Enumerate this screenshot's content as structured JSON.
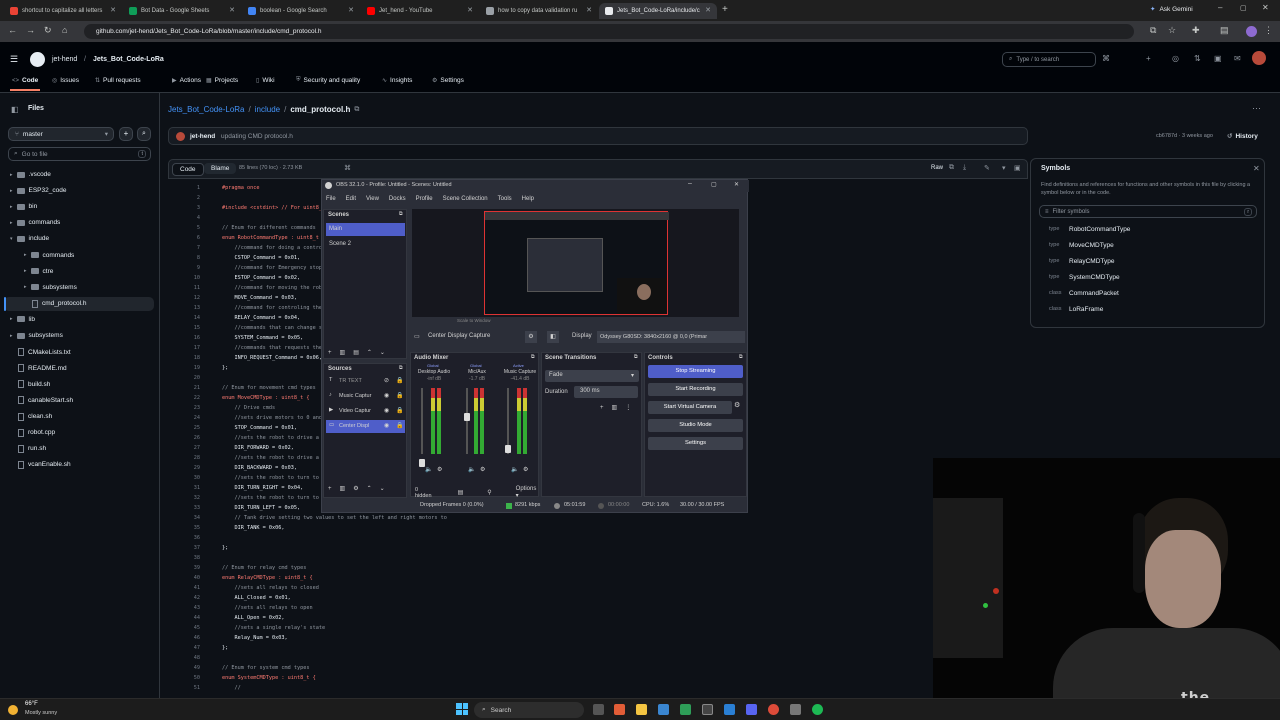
{
  "browser": {
    "tabs": [
      {
        "title": "shortcut to capitalize all letters",
        "color": "#ea4335"
      },
      {
        "title": "Bot Data - Google Sheets",
        "color": "#0f9d58"
      },
      {
        "title": "boolean - Google Search",
        "color": "#4285f4"
      },
      {
        "title": "Jet_hend - YouTube",
        "color": "#ff0000"
      },
      {
        "title": "how to copy data validation ru",
        "color": "#9aa0a6"
      },
      {
        "title": "Jets_Bot_Code-LoRa/include/c",
        "color": "#e8eaed"
      }
    ],
    "ask_gemini": "Ask Gemini",
    "url": "github.com/jet-hend/Jets_Bot_Code-LoRa/blob/master/include/cmd_protocol.h"
  },
  "github": {
    "owner": "jet-hend",
    "repo": "Jets_Bot_Code-LoRa",
    "search_placeholder": "Type / to search",
    "nav": [
      "Code",
      "Issues",
      "Pull requests",
      "Actions",
      "Projects",
      "Wiki",
      "Security and quality",
      "Insights",
      "Settings"
    ],
    "files_title": "Files",
    "branch": "master",
    "goto_placeholder": "Go to file",
    "goto_key": "t",
    "tree": [
      {
        "name": ".vscode",
        "type": "folder",
        "depth": 1
      },
      {
        "name": "ESP32_code",
        "type": "folder",
        "depth": 1
      },
      {
        "name": "bin",
        "type": "folder",
        "depth": 1
      },
      {
        "name": "commands",
        "type": "folder",
        "depth": 1
      },
      {
        "name": "include",
        "type": "folder",
        "depth": 1
      },
      {
        "name": "commands",
        "type": "folder",
        "depth": 2
      },
      {
        "name": "ctre",
        "type": "folder",
        "depth": 2
      },
      {
        "name": "subsystems",
        "type": "folder",
        "depth": 2
      },
      {
        "name": "cmd_protocol.h",
        "type": "file",
        "depth": 2
      },
      {
        "name": "lib",
        "type": "folder",
        "depth": 1
      },
      {
        "name": "subsystems",
        "type": "folder",
        "depth": 1
      },
      {
        "name": "CMakeLists.txt",
        "type": "file",
        "depth": 1
      },
      {
        "name": "README.md",
        "type": "file",
        "depth": 1
      },
      {
        "name": "build.sh",
        "type": "file",
        "depth": 1
      },
      {
        "name": "canableStart.sh",
        "type": "file",
        "depth": 1
      },
      {
        "name": "clean.sh",
        "type": "file",
        "depth": 1
      },
      {
        "name": "robot.cpp",
        "type": "file",
        "depth": 1
      },
      {
        "name": "run.sh",
        "type": "file",
        "depth": 1
      },
      {
        "name": "vcanEnable.sh",
        "type": "file",
        "depth": 1
      }
    ],
    "breadcrumb": {
      "repo": "Jets_Bot_Code-LoRa",
      "sep": "/",
      "dir": "include",
      "file": "cmd_protocol.h"
    },
    "commit": {
      "author": "jet-hend",
      "message": "updating CMD protocol.h",
      "meta": "cb6787d · 3 weeks ago",
      "history": "History"
    },
    "code_tab": "Code",
    "blame_tab": "Blame",
    "file_info": "85 lines (70 loc) · 2.73 KB",
    "raw": "Raw",
    "code_lines": [
      {
        "n": "1",
        "t": "#pragma once"
      },
      {
        "n": "2",
        "t": ""
      },
      {
        "n": "3",
        "t": "#include <cstdint> // For uint8_t"
      },
      {
        "n": "4",
        "t": ""
      },
      {
        "n": "5",
        "t": "// Enum for different commands"
      },
      {
        "n": "6",
        "t": "enum RobotCommandType : uint8_t {"
      },
      {
        "n": "7",
        "t": "    //command for doing a control"
      },
      {
        "n": "8",
        "t": "    CSTOP_Command = 0x01,"
      },
      {
        "n": "9",
        "t": "    //command for Emergency stop"
      },
      {
        "n": "10",
        "t": "    ESTOP_Command = 0x02,"
      },
      {
        "n": "11",
        "t": "    //command for moving the rob"
      },
      {
        "n": "12",
        "t": "    MOVE_Command = 0x03,"
      },
      {
        "n": "13",
        "t": "    //command for controling the"
      },
      {
        "n": "14",
        "t": "    RELAY_Command = 0x04,"
      },
      {
        "n": "15",
        "t": "    //commands that can change s"
      },
      {
        "n": "16",
        "t": "    SYSTEM_Command = 0x05,"
      },
      {
        "n": "17",
        "t": "    //commands that requests the"
      },
      {
        "n": "18",
        "t": "    INFO_REQUEST_Command = 0x06,"
      },
      {
        "n": "19",
        "t": "};"
      },
      {
        "n": "20",
        "t": ""
      },
      {
        "n": "21",
        "t": "// Enum for movement cmd types"
      },
      {
        "n": "22",
        "t": "enum MoveCMDType : uint8_t {"
      },
      {
        "n": "23",
        "t": "    // Drive cmds"
      },
      {
        "n": "24",
        "t": "    //sets drive motors to 0 and"
      },
      {
        "n": "25",
        "t": "    STOP_Command = 0x01,"
      },
      {
        "n": "26",
        "t": "    //sets the robot to drive a"
      },
      {
        "n": "27",
        "t": "    DIR_FORWARD = 0x02,"
      },
      {
        "n": "28",
        "t": "    //sets the robot to drive a"
      },
      {
        "n": "29",
        "t": "    DIR_BACKWARD = 0x03,"
      },
      {
        "n": "30",
        "t": "    //sets the robot to turn to"
      },
      {
        "n": "31",
        "t": "    DIR_TURN_RIGHT = 0x04,"
      },
      {
        "n": "32",
        "t": "    //sets the robot to turn to"
      },
      {
        "n": "33",
        "t": "    DIR_TURN_LEFT = 0x05,"
      },
      {
        "n": "34",
        "t": "    // Tank drive setting two values to set the left and right motors to"
      },
      {
        "n": "35",
        "t": "    DIR_TANK = 0x06,"
      },
      {
        "n": "36",
        "t": ""
      },
      {
        "n": "37",
        "t": "};"
      },
      {
        "n": "38",
        "t": ""
      },
      {
        "n": "39",
        "t": "// Enum for relay cmd types"
      },
      {
        "n": "40",
        "t": "enum RelayCMDType : uint8_t {"
      },
      {
        "n": "41",
        "t": "    //sets all relays to closed"
      },
      {
        "n": "42",
        "t": "    ALL_Closed = 0x01,"
      },
      {
        "n": "43",
        "t": "    //sets all relays to open"
      },
      {
        "n": "44",
        "t": "    ALL_Open = 0x02,"
      },
      {
        "n": "45",
        "t": "    //sets a single relay's state"
      },
      {
        "n": "46",
        "t": "    Relay_Num = 0x03,"
      },
      {
        "n": "47",
        "t": "};"
      },
      {
        "n": "48",
        "t": ""
      },
      {
        "n": "49",
        "t": "// Enum for system cmd types"
      },
      {
        "n": "50",
        "t": "enum SystemCMDType : uint8_t {"
      },
      {
        "n": "51",
        "t": "    //"
      }
    ],
    "symbols": {
      "title": "Symbols",
      "desc": "Find definitions and references for functions and other symbols in this file by clicking a symbol below or in the code.",
      "filter_placeholder": "Filter symbols",
      "items": [
        {
          "kind": "type",
          "name": "RobotCommandType"
        },
        {
          "kind": "type",
          "name": "MoveCMDType"
        },
        {
          "kind": "type",
          "name": "RelayCMDType"
        },
        {
          "kind": "type",
          "name": "SystemCMDType"
        },
        {
          "kind": "class",
          "name": "CommandPacket"
        },
        {
          "kind": "class",
          "name": "LoRaFrame"
        }
      ]
    }
  },
  "obs": {
    "title": "OBS 32.1.0 - Profile: Untitled - Scenes: Untitled",
    "menu": [
      "File",
      "Edit",
      "View",
      "Docks",
      "Profile",
      "Scene Collection",
      "Tools",
      "Help"
    ],
    "scenes_title": "Scenes",
    "scenes": [
      "Main",
      "Scene 2"
    ],
    "sources_title": "Sources",
    "sources": [
      "TR TEXT",
      "Music Captur",
      "Video Captur",
      "Center Displ"
    ],
    "preview_label": "Scale to Window",
    "source_bar_label": "Center Display Capture",
    "display_label": "Display",
    "display_value": "Odyssey G80SD: 3840x2160 @ 0,0 (Primar",
    "mixer_title": "Audio Mixer",
    "mixer_channels": [
      {
        "name": "Desktop Audio",
        "db": "-inf dB",
        "tag": "Global"
      },
      {
        "name": "Mic/Aux",
        "db": "-1.7 dB",
        "tag": "Global"
      },
      {
        "name": "Music Capture",
        "db": "-41.4 dB",
        "tag": "Active"
      }
    ],
    "transitions_title": "Scene Transitions",
    "transition": "Fade",
    "duration_label": "Duration",
    "duration_value": "300 ms",
    "controls_title": "Controls",
    "controls": [
      "Stop Streaming",
      "Start Recording",
      "Start Virtual Camera",
      "Studio Mode",
      "Settings"
    ],
    "hidden_label": "0 hidden",
    "options_label": "Options",
    "status": {
      "dropped": "Dropped Frames 0 (0.0%)",
      "kbps": "8291 kbps",
      "stream_time": "05:01:59",
      "rec_time": "00:00:00",
      "cpu": "CPU: 1.6%",
      "fps": "30.00 / 30.00 FPS"
    }
  },
  "taskbar": {
    "weather_temp": "66°F",
    "weather_desc": "Mostly sunny",
    "search": "Search"
  },
  "webcam": {
    "shirt_text": "the MOUNTAINS"
  },
  "colors": {
    "accent_blue": "#4f5ec9",
    "github_bg": "#0d1117",
    "link": "#4493f8"
  }
}
